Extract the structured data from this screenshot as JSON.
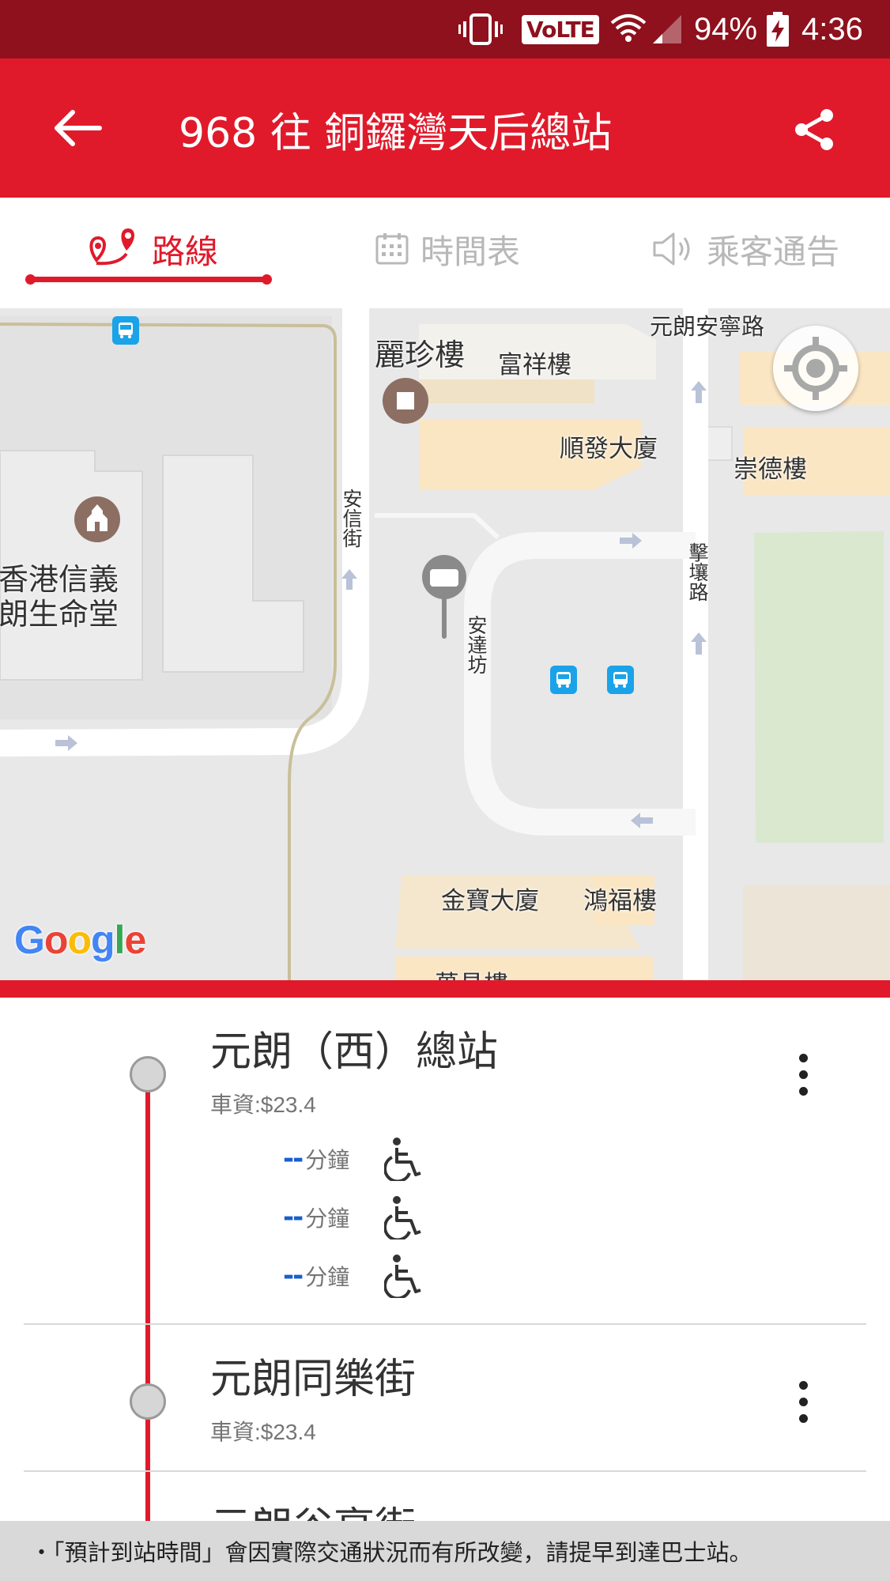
{
  "status_bar": {
    "network": "VoLTE",
    "battery": "94%",
    "time": "4:36",
    "icons": [
      "vibrate-icon",
      "wifi-icon",
      "signal-icon",
      "battery-charging-icon"
    ]
  },
  "header": {
    "title": "968 往 銅鑼灣天后總站",
    "back_icon": "arrow-left-icon",
    "share_icon": "share-icon"
  },
  "tabs": [
    {
      "label": "路線",
      "icon": "route-pin-icon",
      "active": true
    },
    {
      "label": "時間表",
      "icon": "calendar-icon",
      "active": false
    },
    {
      "label": "乘客通告",
      "icon": "speaker-icon",
      "active": false
    }
  ],
  "map": {
    "labels": {
      "yuen_long_on_ning_road": "元朗安寧路",
      "lai_chun_building": "麗珍樓",
      "fu_cheung_building": "富祥樓",
      "shun_fat_building": "順發大廈",
      "sung_tak_building": "崇德樓",
      "church_line1": "香港信義",
      "church_line2": "朗生命堂",
      "on_shun_street": "安信街",
      "on_tat_square": "安達坊",
      "kik_yeung_road": "擊壤路",
      "kam_po_building": "金寶大廈",
      "hung_fuk_building": "鴻福樓",
      "partial_building": "萬昌樓"
    },
    "attribution": "Google",
    "locate_icon": "my-location-icon"
  },
  "stops": [
    {
      "name": "元朗（西）總站",
      "fare": "車資:$23.4",
      "etas": [
        {
          "value": "--",
          "unit": "分鐘"
        },
        {
          "value": "--",
          "unit": "分鐘"
        },
        {
          "value": "--",
          "unit": "分鐘"
        }
      ]
    },
    {
      "name": "元朗同樂街",
      "fare": "車資:$23.4"
    },
    {
      "name": "元朗谷亭街"
    }
  ],
  "notice": "・「預計到站時間」會因實際交通狀況而有所改變，請提早到達巴士站。",
  "colors": {
    "brand_red": "#e01a2b",
    "status_bar": "#8e111d",
    "eta_blue": "#1a5fcc"
  }
}
